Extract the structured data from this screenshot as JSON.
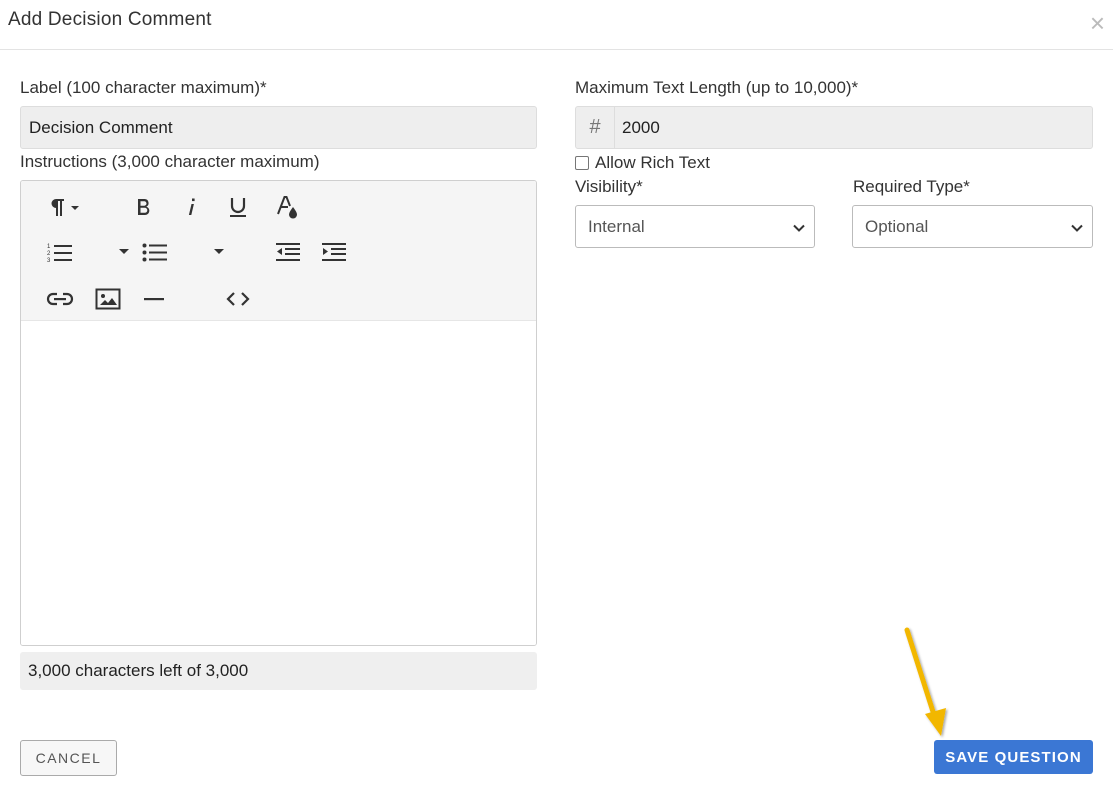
{
  "dialog": {
    "title": "Add Decision Comment",
    "close_label": "×"
  },
  "label_field": {
    "label": "Label (100 character maximum)*",
    "value": "Decision Comment"
  },
  "instructions_field": {
    "label": "Instructions (3,000 character maximum)",
    "toolbar_icons": [
      "paragraph-icon",
      "bold-icon",
      "italic-icon",
      "underline-icon",
      "text-color-icon",
      "ordered-list-icon",
      "unordered-list-icon",
      "outdent-icon",
      "indent-icon",
      "link-icon",
      "image-icon",
      "horizontal-rule-icon",
      "code-view-icon"
    ],
    "counter": "3,000 characters left of 3,000"
  },
  "max_length_field": {
    "label": "Maximum Text Length (up to 10,000)*",
    "addon": "#",
    "value": "2000"
  },
  "rich_text": {
    "label": "Allow Rich Text",
    "checked": false
  },
  "visibility": {
    "label": "Visibility*",
    "selected": "Internal"
  },
  "required_type": {
    "label": "Required Type*",
    "selected": "Optional"
  },
  "footer": {
    "cancel_label": "CANCEL",
    "save_label": "SAVE QUESTION"
  },
  "colors": {
    "primary": "#3b77d4",
    "annotation_arrow": "#f2b705"
  }
}
